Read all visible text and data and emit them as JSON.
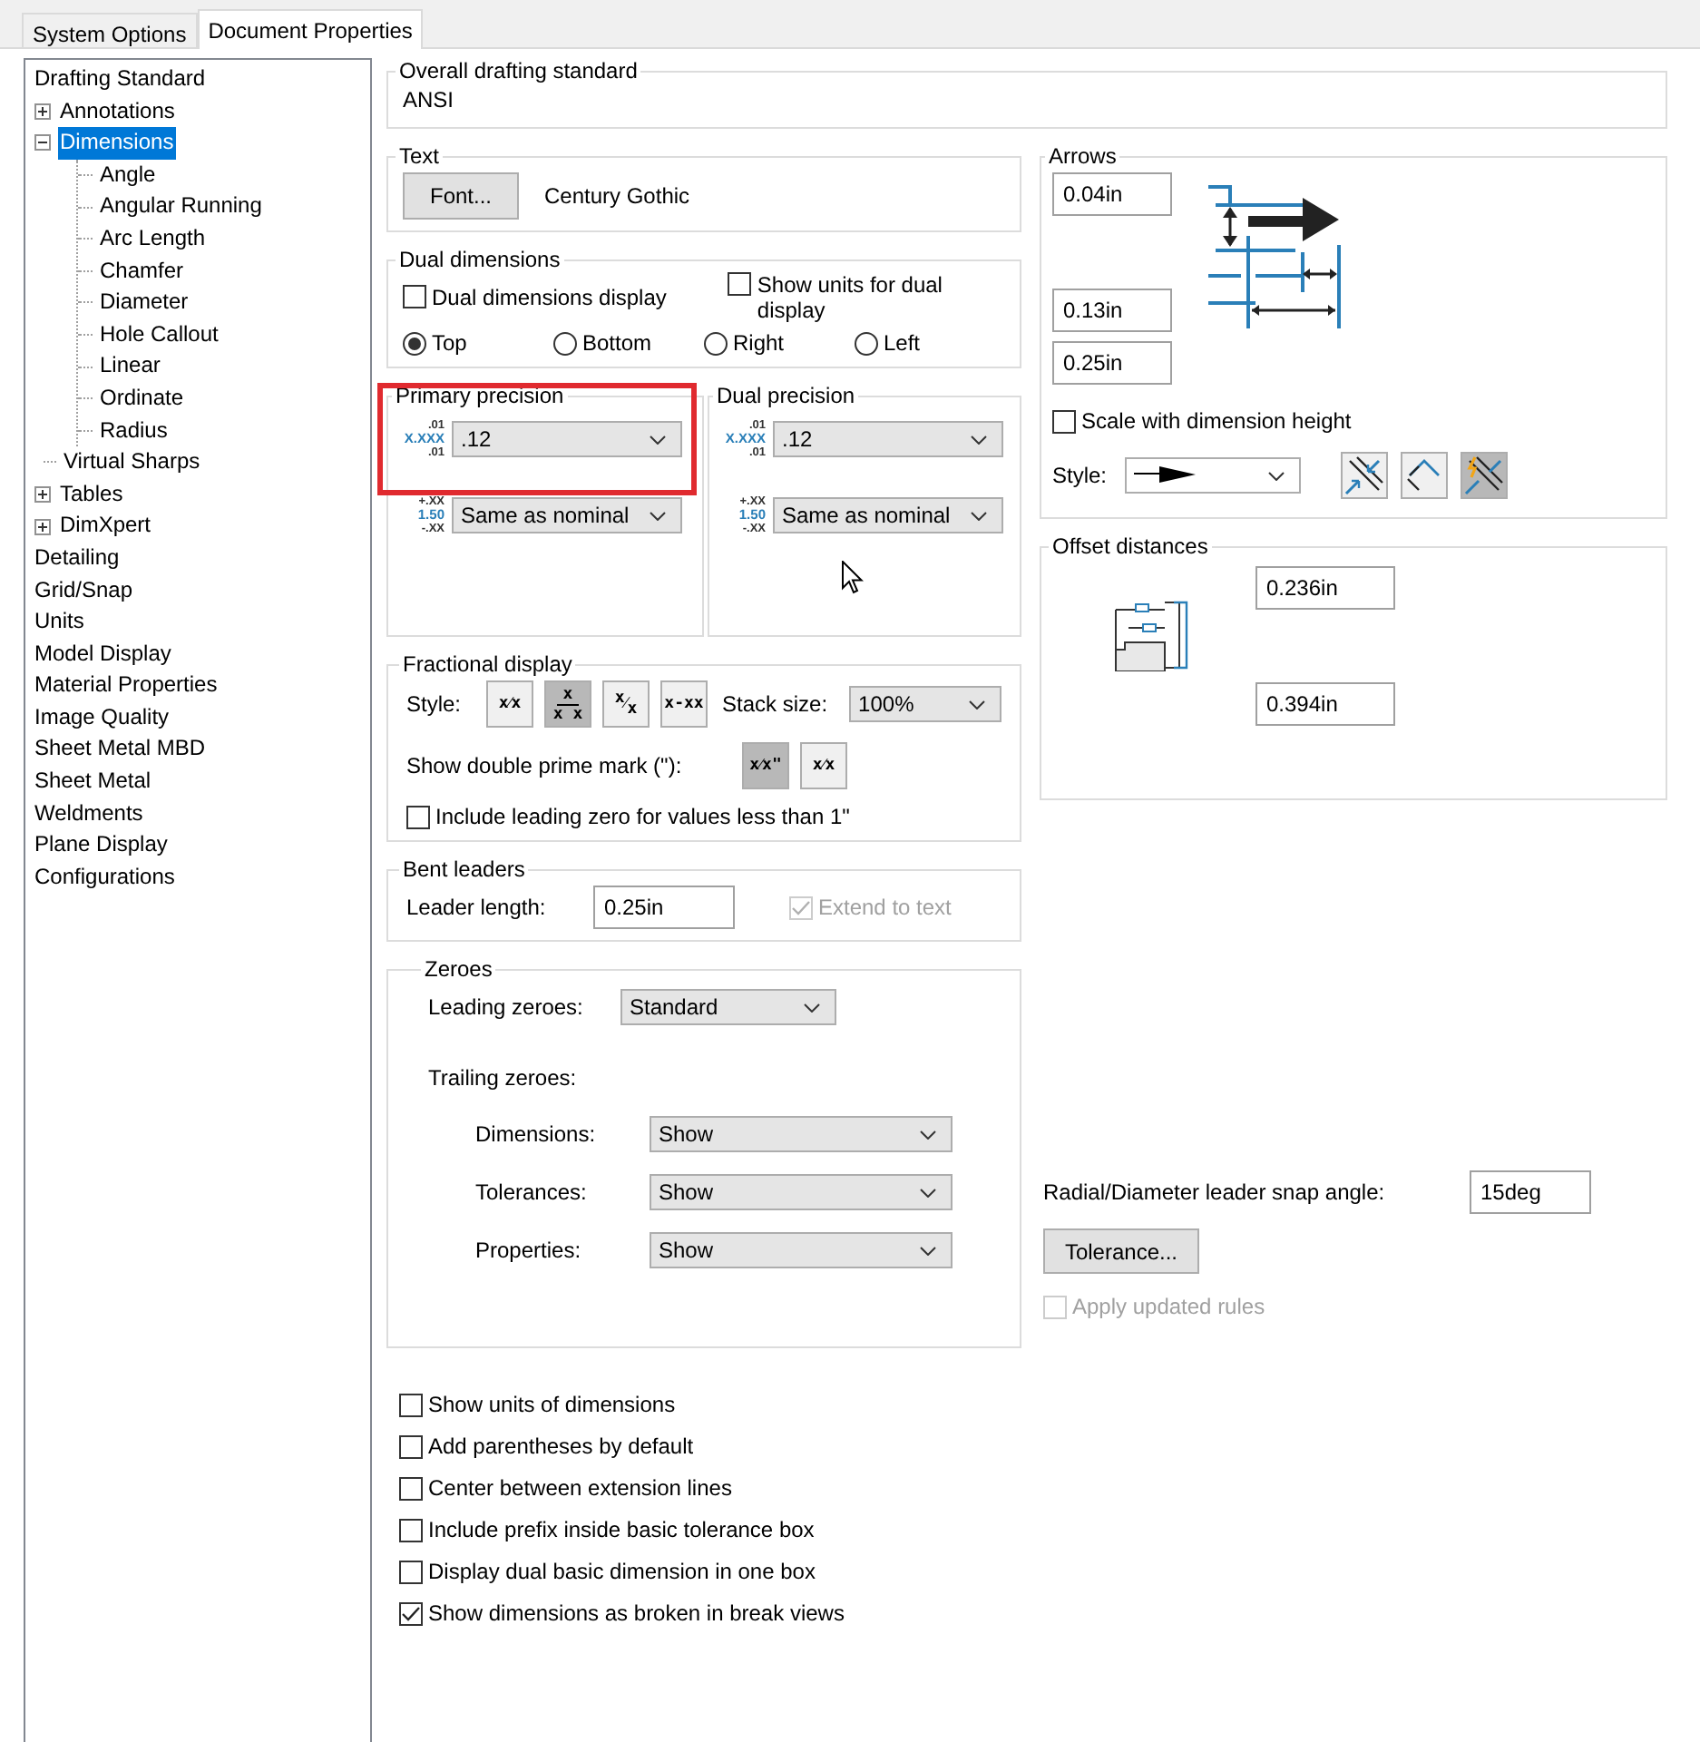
{
  "tabs": [
    {
      "label": "System Options",
      "selected": false
    },
    {
      "label": "Document Properties",
      "selected": true
    }
  ],
  "tree": [
    {
      "label": "Drafting Standard",
      "kind": "plain",
      "selected": false
    },
    {
      "label": "Annotations",
      "kind": "node",
      "expanded": false,
      "selected": false
    },
    {
      "label": "Dimensions",
      "kind": "node",
      "expanded": true,
      "selected": true,
      "children": [
        {
          "label": "Angle",
          "selected": false
        },
        {
          "label": "Angular Running",
          "selected": false
        },
        {
          "label": "Arc Length",
          "selected": false
        },
        {
          "label": "Chamfer",
          "selected": false
        },
        {
          "label": "Diameter",
          "selected": false
        },
        {
          "label": "Hole Callout",
          "selected": false
        },
        {
          "label": "Linear",
          "selected": false
        },
        {
          "label": "Ordinate",
          "selected": false
        },
        {
          "label": "Radius",
          "selected": false
        }
      ]
    },
    {
      "label": "Virtual Sharps",
      "kind": "node",
      "selected": false
    },
    {
      "label": "Tables",
      "kind": "node",
      "expanded": false,
      "selected": false
    },
    {
      "label": "DimXpert",
      "kind": "node",
      "expanded": false,
      "selected": false
    },
    {
      "label": "Detailing",
      "kind": "plain",
      "selected": false
    },
    {
      "label": "Grid/Snap",
      "kind": "plain",
      "selected": false
    },
    {
      "label": "Units",
      "kind": "plain",
      "selected": false
    },
    {
      "label": "Model Display",
      "kind": "plain",
      "selected": false
    },
    {
      "label": "Material Properties",
      "kind": "plain",
      "selected": false
    },
    {
      "label": "Image Quality",
      "kind": "plain",
      "selected": false
    },
    {
      "label": "Sheet Metal MBD",
      "kind": "plain",
      "selected": false
    },
    {
      "label": "Sheet Metal",
      "kind": "plain",
      "selected": false
    },
    {
      "label": "Weldments",
      "kind": "plain",
      "selected": false
    },
    {
      "label": "Plane Display",
      "kind": "plain",
      "selected": false
    },
    {
      "label": "Configurations",
      "kind": "plain",
      "selected": false
    }
  ],
  "drafting_standard": {
    "title": "Overall drafting standard",
    "value": "ANSI"
  },
  "text_group": {
    "title": "Text",
    "font_button": "Font...",
    "font_name": "Century Gothic"
  },
  "dual_dimensions": {
    "title": "Dual dimensions",
    "checkboxes": [
      {
        "label": "Dual dimensions display",
        "checked": false
      },
      {
        "label": "Show units for dual display",
        "checked": false
      }
    ],
    "positions": [
      {
        "label": "Top",
        "selected": true
      },
      {
        "label": "Bottom",
        "selected": false
      },
      {
        "label": "Right",
        "selected": false
      },
      {
        "label": "Left",
        "selected": false
      }
    ]
  },
  "precision": [
    {
      "title": "Primary precision",
      "highlighted": true,
      "value_icon": [
        ".01",
        "X.XXX",
        ".01"
      ],
      "value": ".12",
      "tolerance_icon": [
        "+.XX",
        "1.50",
        "-.XX"
      ],
      "tolerance": "Same as nominal"
    },
    {
      "title": "Dual precision",
      "highlighted": false,
      "value_icon": [
        ".01",
        "X.XXX",
        ".01"
      ],
      "value": ".12",
      "tolerance_icon": [
        "+.XX",
        "1.50",
        "-.XX"
      ],
      "tolerance": "Same as nominal"
    }
  ],
  "fractional_display": {
    "title": "Fractional display",
    "style_label": "Style:",
    "styles": [
      {
        "kind": "inline",
        "label": "x⁄x",
        "selected": false
      },
      {
        "kind": "stacked",
        "numerator": "x",
        "denominator": "x x",
        "selected": true
      },
      {
        "kind": "diagonal",
        "numerator": "x",
        "separator": "⁄",
        "denominator": "x",
        "selected": false
      },
      {
        "kind": "inline",
        "label": "x-xx",
        "selected": false
      }
    ],
    "stack_size_label": "Stack size:",
    "stack_size": "100%",
    "double_prime_label": "Show double prime mark (\"):",
    "prime_options": [
      {
        "label": "x⁄x\"",
        "selected": true
      },
      {
        "label": "x⁄x",
        "selected": false
      }
    ],
    "leading_zero": {
      "label": "Include leading zero for values less than 1\"",
      "checked": false
    }
  },
  "bent_leaders": {
    "title": "Bent leaders",
    "length_label": "Leader length:",
    "length": "0.25in",
    "extend": {
      "label": "Extend to text",
      "checked": true,
      "disabled": true
    }
  },
  "zeroes": {
    "title": "Zeroes",
    "leading_label": "Leading zeroes:",
    "leading": "Standard",
    "trailing_label": "Trailing zeroes:",
    "trailing": [
      {
        "label": "Dimensions:",
        "value": "Show"
      },
      {
        "label": "Tolerances:",
        "value": "Show"
      },
      {
        "label": "Properties:",
        "value": "Show"
      }
    ]
  },
  "options": [
    {
      "label": "Show units of dimensions",
      "checked": false
    },
    {
      "label": "Add parentheses by default",
      "checked": false
    },
    {
      "label": "Center between extension lines",
      "checked": false
    },
    {
      "label": "Include prefix inside basic tolerance box",
      "checked": false
    },
    {
      "label": "Display dual basic dimension in one box",
      "checked": false
    },
    {
      "label": "Show dimensions as broken in break views",
      "checked": true
    }
  ],
  "arrows": {
    "title": "Arrows",
    "sizes": [
      "0.04in",
      "0.13in",
      "0.25in"
    ],
    "scale": {
      "label": "Scale with dimension height",
      "checked": false
    },
    "style_label": "Style:",
    "placement": [
      {
        "kind": "inside",
        "selected": false
      },
      {
        "kind": "outside",
        "selected": false
      },
      {
        "kind": "smart",
        "selected": true
      }
    ]
  },
  "offset": {
    "title": "Offset distances",
    "values": [
      "0.236in",
      "0.394in"
    ]
  },
  "snap": {
    "label": "Radial/Diameter leader snap angle:",
    "value": "15deg"
  },
  "tolerance_button": "Tolerance...",
  "apply_rules": {
    "label": "Apply updated rules",
    "checked": false,
    "disabled": true
  }
}
